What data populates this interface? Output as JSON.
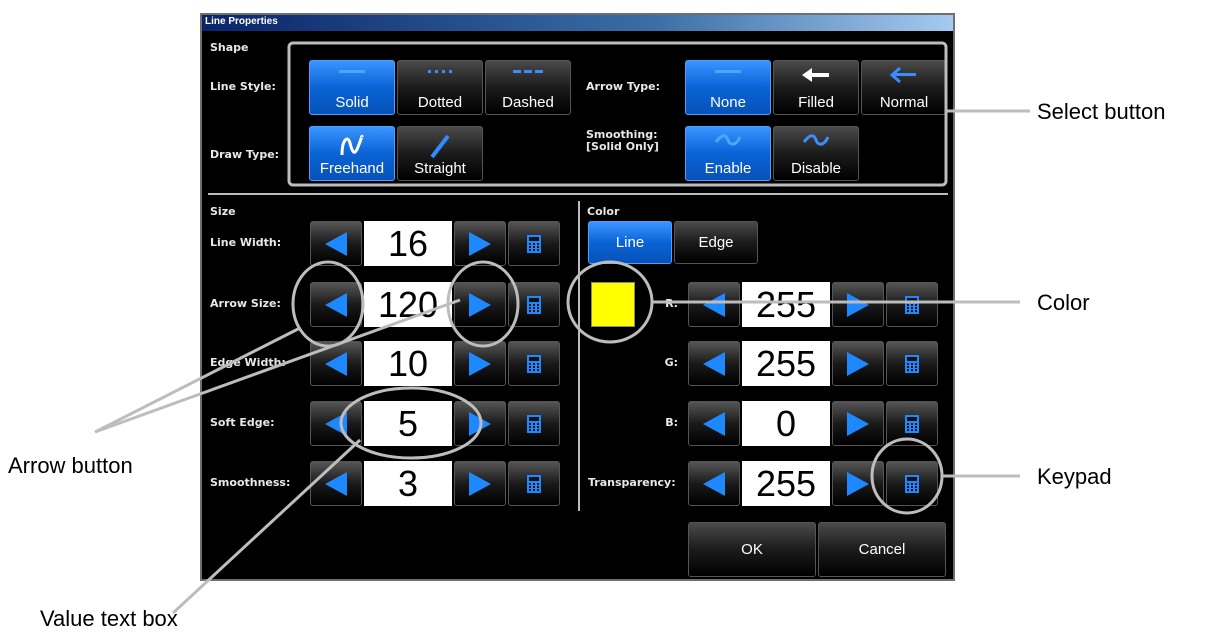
{
  "window": {
    "title": "Line Properties"
  },
  "shape": {
    "section_label": "Shape",
    "line_style_label": "Line Style:",
    "line_style_options": [
      "Solid",
      "Dotted",
      "Dashed"
    ],
    "line_style_selected": "Solid",
    "draw_type_label": "Draw Type:",
    "draw_type_options": [
      "Freehand",
      "Straight"
    ],
    "draw_type_selected": "Freehand",
    "arrow_type_label": "Arrow Type:",
    "arrow_type_options": [
      "None",
      "Filled",
      "Normal"
    ],
    "arrow_type_selected": "None",
    "smoothing_label_1": "Smoothing:",
    "smoothing_label_2": "[Solid Only]",
    "smoothing_options": [
      "Enable",
      "Disable"
    ],
    "smoothing_selected": "Enable"
  },
  "size": {
    "section_label": "Size",
    "rows": [
      {
        "label": "Line Width:",
        "value": "16"
      },
      {
        "label": "Arrow Size:",
        "value": "120"
      },
      {
        "label": "Edge Width:",
        "value": "10"
      },
      {
        "label": "Soft Edge:",
        "value": "5"
      },
      {
        "label": "Smoothness:",
        "value": "3"
      }
    ]
  },
  "color": {
    "section_label": "Color",
    "tabs": [
      "Line",
      "Edge"
    ],
    "tab_selected": "Line",
    "swatch_color": "#ffff00",
    "rows": [
      {
        "label": "R:",
        "value": "255"
      },
      {
        "label": "G:",
        "value": "255"
      },
      {
        "label": "B:",
        "value": "0"
      },
      {
        "label": "Transparency:",
        "value": "255"
      }
    ]
  },
  "actions": {
    "ok": "OK",
    "cancel": "Cancel"
  },
  "annotations": {
    "select_button": "Select button",
    "color": "Color",
    "arrow_button": "Arrow button",
    "keypad": "Keypad",
    "value_text_box": "Value text box"
  },
  "colors": {
    "accent": "#0a63d6",
    "arrow": "#1e88ff",
    "callout_line": "#bdbdbd"
  },
  "icons": [
    "arrow-left-icon",
    "arrow-right-icon",
    "keypad-icon",
    "solid-line-icon",
    "dotted-line-icon",
    "dashed-line-icon",
    "freehand-icon",
    "straight-icon",
    "filled-arrow-icon",
    "normal-arrow-icon",
    "wave-icon"
  ]
}
